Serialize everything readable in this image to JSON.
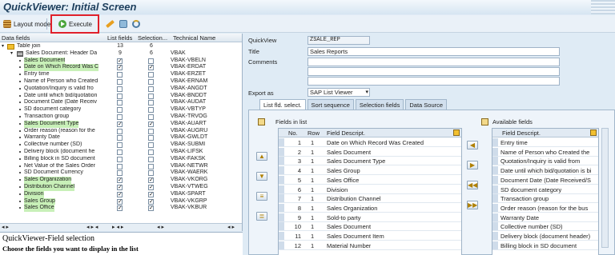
{
  "window": {
    "title": "QuickViewer: Initial Screen"
  },
  "toolbar": {
    "layout_mode": "Layout mode",
    "execute": "Execute"
  },
  "tree": {
    "headers": {
      "data_fields": "Data fields",
      "list_fields": "List fields",
      "selection": "Selection...",
      "technical_name": "Technical Name"
    },
    "rows": [
      {
        "label": "Table join",
        "list": "13",
        "sel": "6",
        "tech": ""
      },
      {
        "label": "Sales Document: Header Da",
        "list": "9",
        "sel": "6",
        "tech": "VBAK"
      },
      {
        "label": "Sales Document",
        "tech": "VBAK-VBELN"
      },
      {
        "label": "Date on Which Record Was C",
        "tech": "VBAK-ERDAT"
      },
      {
        "label": "Entry time",
        "tech": "VBAK-ERZET"
      },
      {
        "label": "Name of Person who Created",
        "tech": "VBAK-ERNAM"
      },
      {
        "label": "Quotation/Inquiry is valid fro",
        "tech": "VBAK-ANGDT"
      },
      {
        "label": "Date until which bid/quotation",
        "tech": "VBAK-BNDDT"
      },
      {
        "label": "Document Date (Date Receiv",
        "tech": "VBAK-AUDAT"
      },
      {
        "label": "SD document category",
        "tech": "VBAK-VBTYP"
      },
      {
        "label": "Transaction group",
        "tech": "VBAK-TRVOG"
      },
      {
        "label": "Sales Document Type",
        "tech": "VBAK-AUART"
      },
      {
        "label": "Order reason (reason for the",
        "tech": "VBAK-AUGRU"
      },
      {
        "label": "Warranty Date",
        "tech": "VBAK-GWLDT"
      },
      {
        "label": "Collective number (SD)",
        "tech": "VBAK-SUBMI"
      },
      {
        "label": "Delivery block (document he",
        "tech": "VBAK-LIFSK"
      },
      {
        "label": "Billing block in SD document",
        "tech": "VBAK-FAKSK"
      },
      {
        "label": "Net Value of the Sales Order",
        "tech": "VBAK-NETWR"
      },
      {
        "label": "SD Document Currency",
        "tech": "VBAK-WAERK"
      },
      {
        "label": "Sales Organization",
        "tech": "VBAK-VKORG"
      },
      {
        "label": "Distribution Channel",
        "tech": "VBAK-VTWEG"
      },
      {
        "label": "Division",
        "tech": "VBAK-SPART"
      },
      {
        "label": "Sales Group",
        "tech": "VBAK-VKGRP"
      },
      {
        "label": "Sales Office",
        "tech": "VBAK-VKBUR"
      }
    ]
  },
  "help": {
    "title": "QuickViewer-Field selection",
    "subtitle": "Choose the fields you want to display in the list"
  },
  "form": {
    "quickview_label": "QuickView",
    "quickview_value": "ZSALE_REP",
    "title_label": "Title",
    "title_value": "Sales Reports",
    "comments_label": "Comments",
    "export_label": "Export as",
    "export_value": "SAP List Viewer"
  },
  "tabs": [
    "List fld. select.",
    "Sort sequence",
    "Selection fields",
    "Data Source"
  ],
  "fields_in_list": {
    "title": "Fields in list",
    "headers": {
      "no": "No.",
      "row": "Row",
      "desc": "Field Descript."
    },
    "rows": [
      {
        "no": "1",
        "row": "1",
        "desc": "Date on Which Record Was Created"
      },
      {
        "no": "2",
        "row": "1",
        "desc": "Sales Document"
      },
      {
        "no": "3",
        "row": "1",
        "desc": "Sales Document Type"
      },
      {
        "no": "4",
        "row": "1",
        "desc": "Sales Group"
      },
      {
        "no": "5",
        "row": "1",
        "desc": "Sales Office"
      },
      {
        "no": "6",
        "row": "1",
        "desc": "Division"
      },
      {
        "no": "7",
        "row": "1",
        "desc": "Distribution Channel"
      },
      {
        "no": "8",
        "row": "1",
        "desc": "Sales Organization"
      },
      {
        "no": "9",
        "row": "1",
        "desc": "Sold-to party"
      },
      {
        "no": "10",
        "row": "1",
        "desc": "Sales Document"
      },
      {
        "no": "11",
        "row": "1",
        "desc": "Sales Document Item"
      },
      {
        "no": "12",
        "row": "1",
        "desc": "Material Number"
      }
    ]
  },
  "available_fields": {
    "title": "Available fields",
    "headers": {
      "desc": "Field Descript."
    },
    "rows": [
      "Entry time",
      "Name of Person who Created the",
      "Quotation/Inquiry is valid from",
      "Date until which bid/quotation is bi",
      "Document Date (Date Received/S",
      "SD document category",
      "Transaction group",
      "Order reason (reason for the bus",
      "Warranty Date",
      "Collective number (SD)",
      "Delivery block (document header)",
      "Billing block in SD document"
    ]
  },
  "colors": {
    "highlight": "#c8f0b8",
    "execute_box": "#e0202a",
    "title": "#1d3e5c"
  }
}
